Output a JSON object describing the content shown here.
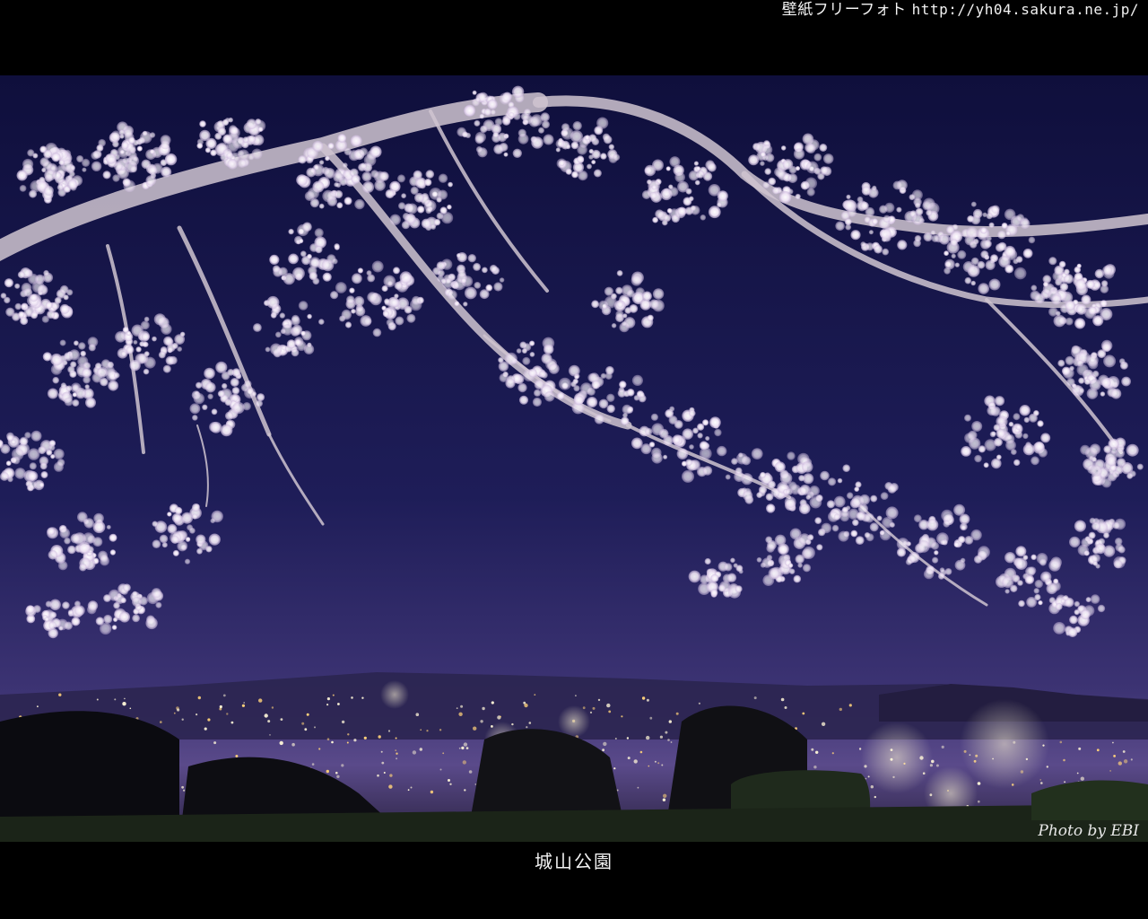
{
  "header": {
    "site_name": "壁紙フリーフォト",
    "site_url": "http://yh04.sakura.ne.jp/"
  },
  "photo": {
    "signature": "Photo by EBI",
    "colors": {
      "sky_top": "#15144a",
      "sky_horizon": "#5a4a8a",
      "blossom": "#f1e9f7",
      "branch": "#d8cfd6",
      "city_light": "#fff6d8"
    }
  },
  "caption": "城山公園"
}
